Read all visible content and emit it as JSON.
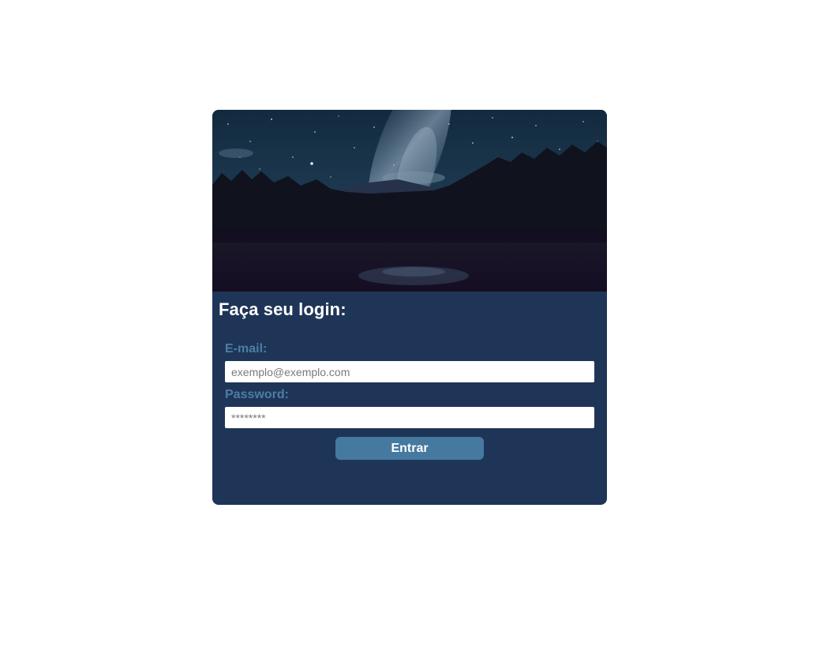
{
  "login": {
    "title": "Faça seu login:",
    "email_label": "E-mail:",
    "email_placeholder": "exemplo@exemplo.com",
    "email_value": "",
    "password_label": "Password:",
    "password_placeholder": "********",
    "password_value": "",
    "submit_label": "Entrar"
  },
  "colors": {
    "card_background": "#1f3557",
    "label_color": "#4a7ea2",
    "button_background": "#46799f",
    "title_color": "#ffffff"
  }
}
